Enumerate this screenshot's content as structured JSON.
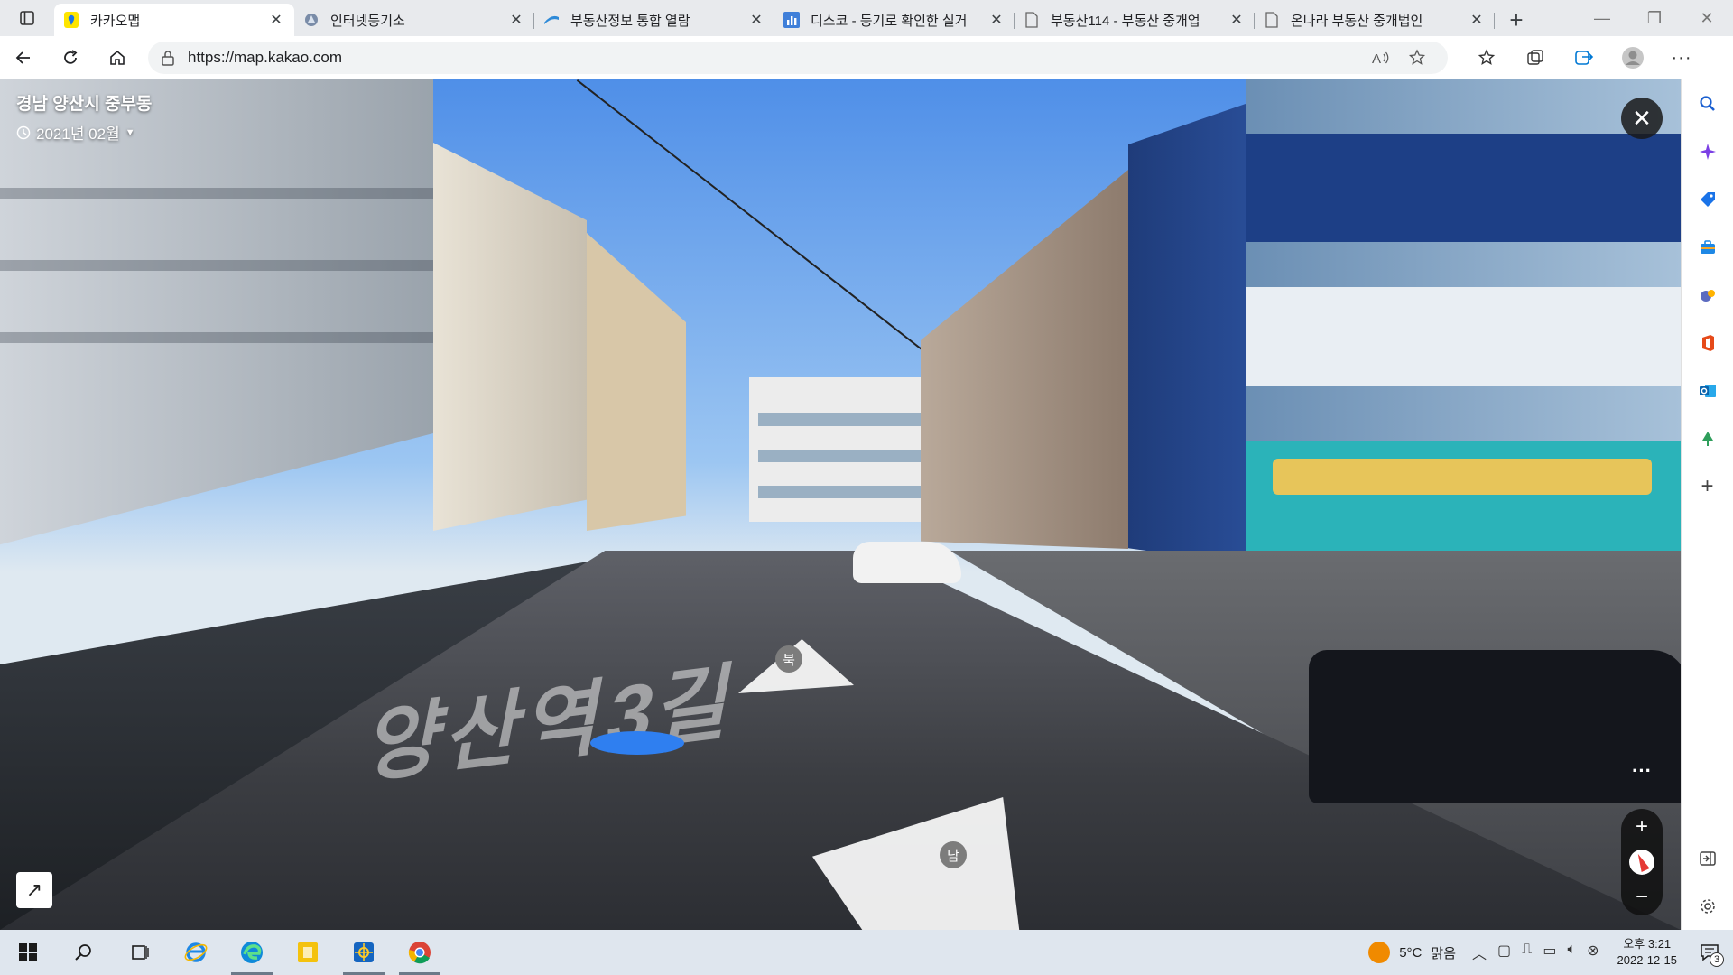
{
  "browser": {
    "tabs": [
      {
        "title": "카카오맵",
        "active": true,
        "favicon": "kakaomap-pin-icon"
      },
      {
        "title": "인터넷등기소",
        "active": false,
        "favicon": "registry-icon"
      },
      {
        "title": "부동산정보 통합 열람",
        "active": false,
        "favicon": "realestate-info-icon"
      },
      {
        "title": "디스코 - 등기로 확인한 실거",
        "active": false,
        "favicon": "chart-bar-icon"
      },
      {
        "title": "부동산114 - 부동산 중개업",
        "active": false,
        "favicon": "page-icon"
      },
      {
        "title": "온나라 부동산 중개법인",
        "active": false,
        "favicon": "page-icon"
      }
    ],
    "url": "https://map.kakao.com"
  },
  "streetview": {
    "location": "경남 양산시 중부동",
    "date": "2021년 02월",
    "road_marking": "양산역3길",
    "arrow_north_label": "북",
    "arrow_south_label": "남"
  },
  "taskbar": {
    "weather_temp": "5°C",
    "weather_desc": "맑음",
    "time": "오후 3:21",
    "date": "2022-12-15",
    "notification_count": "3"
  },
  "colors": {
    "kakao_yellow": "#FEE500",
    "edge_blue": "#0078d4",
    "close_bg": "#191919",
    "accent_blue_spot": "#2f7ff0"
  }
}
